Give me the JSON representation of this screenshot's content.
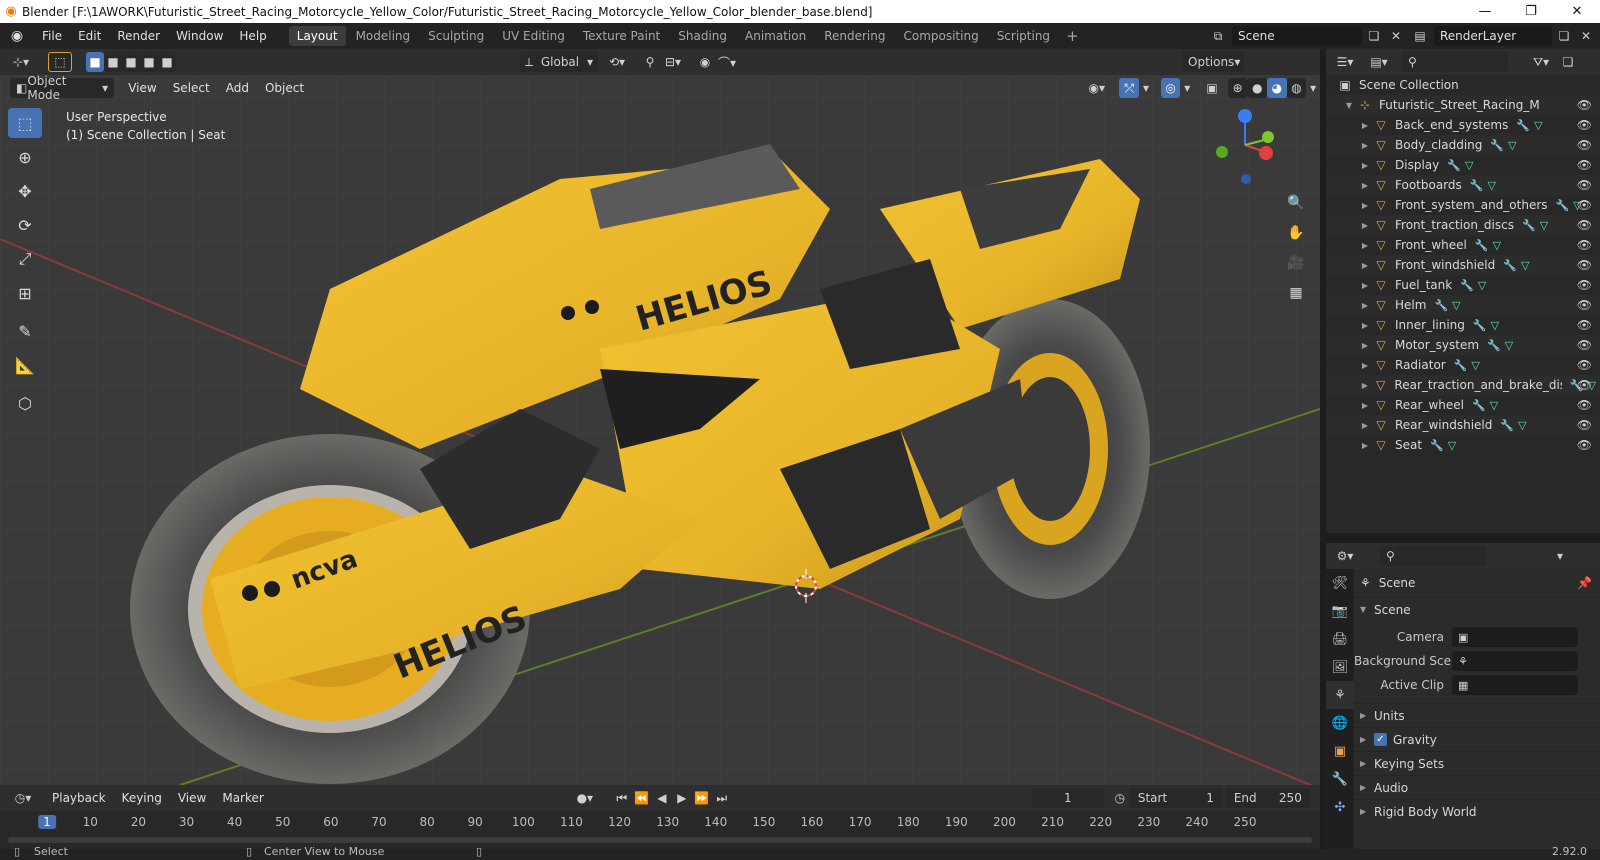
{
  "window": {
    "title": "Blender [F:\\1AWORK\\Futuristic_Street_Racing_Motorcycle_Yellow_Color/Futuristic_Street_Racing_Motorcycle_Yellow_Color_blender_base.blend]"
  },
  "menu": [
    "File",
    "Edit",
    "Render",
    "Window",
    "Help"
  ],
  "workspaces": [
    "Layout",
    "Modeling",
    "Sculpting",
    "UV Editing",
    "Texture Paint",
    "Shading",
    "Animation",
    "Rendering",
    "Compositing",
    "Scripting"
  ],
  "active_workspace": "Layout",
  "scene_name": "Scene",
  "view_layer": "RenderLayer",
  "viewport": {
    "transform_orientation": "Global",
    "options_label": "Options",
    "mode": "Object Mode",
    "menus": [
      "View",
      "Select",
      "Add",
      "Object"
    ],
    "info_line1": "User Perspective",
    "info_line2": "(1) Scene Collection | Seat"
  },
  "outliner": {
    "root": "Scene Collection",
    "collection": "Futuristic_Street_Racing_Motorcy",
    "objects": [
      "Back_end_systems",
      "Body_cladding",
      "Display",
      "Footboards",
      "Front_system_and_others",
      "Front_traction_discs",
      "Front_wheel",
      "Front_windshield",
      "Fuel_tank",
      "Helm",
      "Inner_lining",
      "Motor_system",
      "Radiator",
      "Rear_traction_and_brake_dis",
      "Rear_wheel",
      "Rear_windshield",
      "Seat"
    ]
  },
  "properties": {
    "context": "Scene",
    "panel": "Scene",
    "camera_label": "Camera",
    "background_label": "Background Sce...",
    "active_clip_label": "Active Clip",
    "subpanels": [
      "Units",
      "Gravity",
      "Keying Sets",
      "Audio",
      "Rigid Body World"
    ]
  },
  "timeline": {
    "menus": [
      "Playback",
      "Keying",
      "View",
      "Marker"
    ],
    "current_frame": "1",
    "start_label": "Start",
    "start": "1",
    "end_label": "End",
    "end": "250",
    "ticks": [
      "1",
      "10",
      "20",
      "30",
      "40",
      "50",
      "60",
      "70",
      "80",
      "90",
      "100",
      "110",
      "120",
      "130",
      "140",
      "150",
      "160",
      "170",
      "180",
      "190",
      "200",
      "210",
      "220",
      "230",
      "240",
      "250"
    ]
  },
  "status": {
    "select": "Select",
    "center_view": "Center View to Mouse",
    "version": "2.92.0"
  }
}
